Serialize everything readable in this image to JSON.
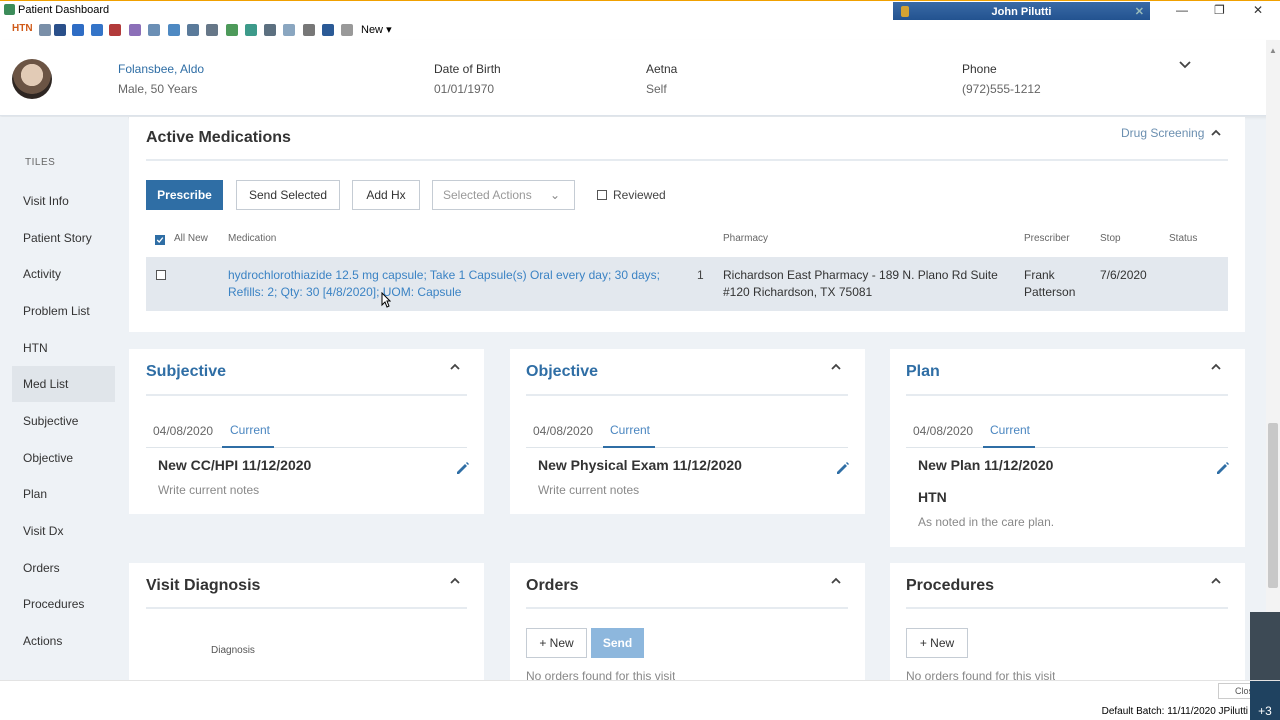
{
  "window": {
    "title": "Patient Dashboard",
    "user": "John Pilutti"
  },
  "toolbar": {
    "htn": "HTN",
    "new_label": "New"
  },
  "patient": {
    "name": "Folansbee, Aldo",
    "sex_age": "Male, 50 Years",
    "dob_label": "Date of Birth",
    "dob": "01/01/1970",
    "insurance_label": "Aetna",
    "insurance_value": "Self",
    "phone_label": "Phone",
    "phone": "(972)555-1212"
  },
  "sidebar": {
    "header": "TILES",
    "items": [
      "Visit Info",
      "Patient Story",
      "Activity",
      "Problem List",
      "HTN",
      "Med List",
      "Subjective",
      "Objective",
      "Plan",
      "Visit Dx",
      "Orders",
      "Procedures",
      "Actions"
    ],
    "active": "Med List"
  },
  "medications": {
    "title": "Active Medications",
    "drug_screening": "Drug Screening",
    "prescribe": "Prescribe",
    "send_selected": "Send Selected",
    "add_hx": "Add Hx",
    "selected_actions": "Selected Actions",
    "reviewed": "Reviewed",
    "columns": {
      "all_new": "All New",
      "medication": "Medication",
      "pharmacy": "Pharmacy",
      "prescriber": "Prescriber",
      "stop": "Stop",
      "status": "Status"
    },
    "row": {
      "medication_line1": "hydrochlorothiazide 12.5 mg capsule; Take 1 Capsule(s) Oral every day; 30 days;",
      "medication_line2": "Refills: 2; Qty: 30 [4/8/2020]; UOM: Capsule",
      "count": "1",
      "pharmacy_line1": "Richardson East Pharmacy - 189 N. Plano Rd Suite",
      "pharmacy_line2": "#120 Richardson, TX 75081",
      "prescriber_line1": "Frank",
      "prescriber_line2": "Patterson",
      "stop": "7/6/2020",
      "status": ""
    }
  },
  "subjective": {
    "title": "Subjective",
    "date": "04/08/2020",
    "current": "Current",
    "note_title": "New CC/HPI 11/12/2020",
    "note_sub": "Write current notes"
  },
  "objective": {
    "title": "Objective",
    "date": "04/08/2020",
    "current": "Current",
    "note_title": "New Physical Exam 11/12/2020",
    "note_sub": "Write current notes"
  },
  "plan": {
    "title": "Plan",
    "date": "04/08/2020",
    "current": "Current",
    "note_title": "New Plan 11/12/2020",
    "problem": "HTN",
    "problem_note": "As noted in the care plan."
  },
  "visit_diagnosis": {
    "title": "Visit Diagnosis",
    "col": "Diagnosis"
  },
  "orders": {
    "title": "Orders",
    "new": "+ New",
    "send": "Send",
    "empty": "No orders found for this visit"
  },
  "procedures": {
    "title": "Procedures",
    "new": "+ New",
    "empty": "No orders found for this visit"
  },
  "statusbar": {
    "batch": "Default Batch: 11/11/2020 JPilutti",
    "close": "Close",
    "plus": "+3"
  }
}
